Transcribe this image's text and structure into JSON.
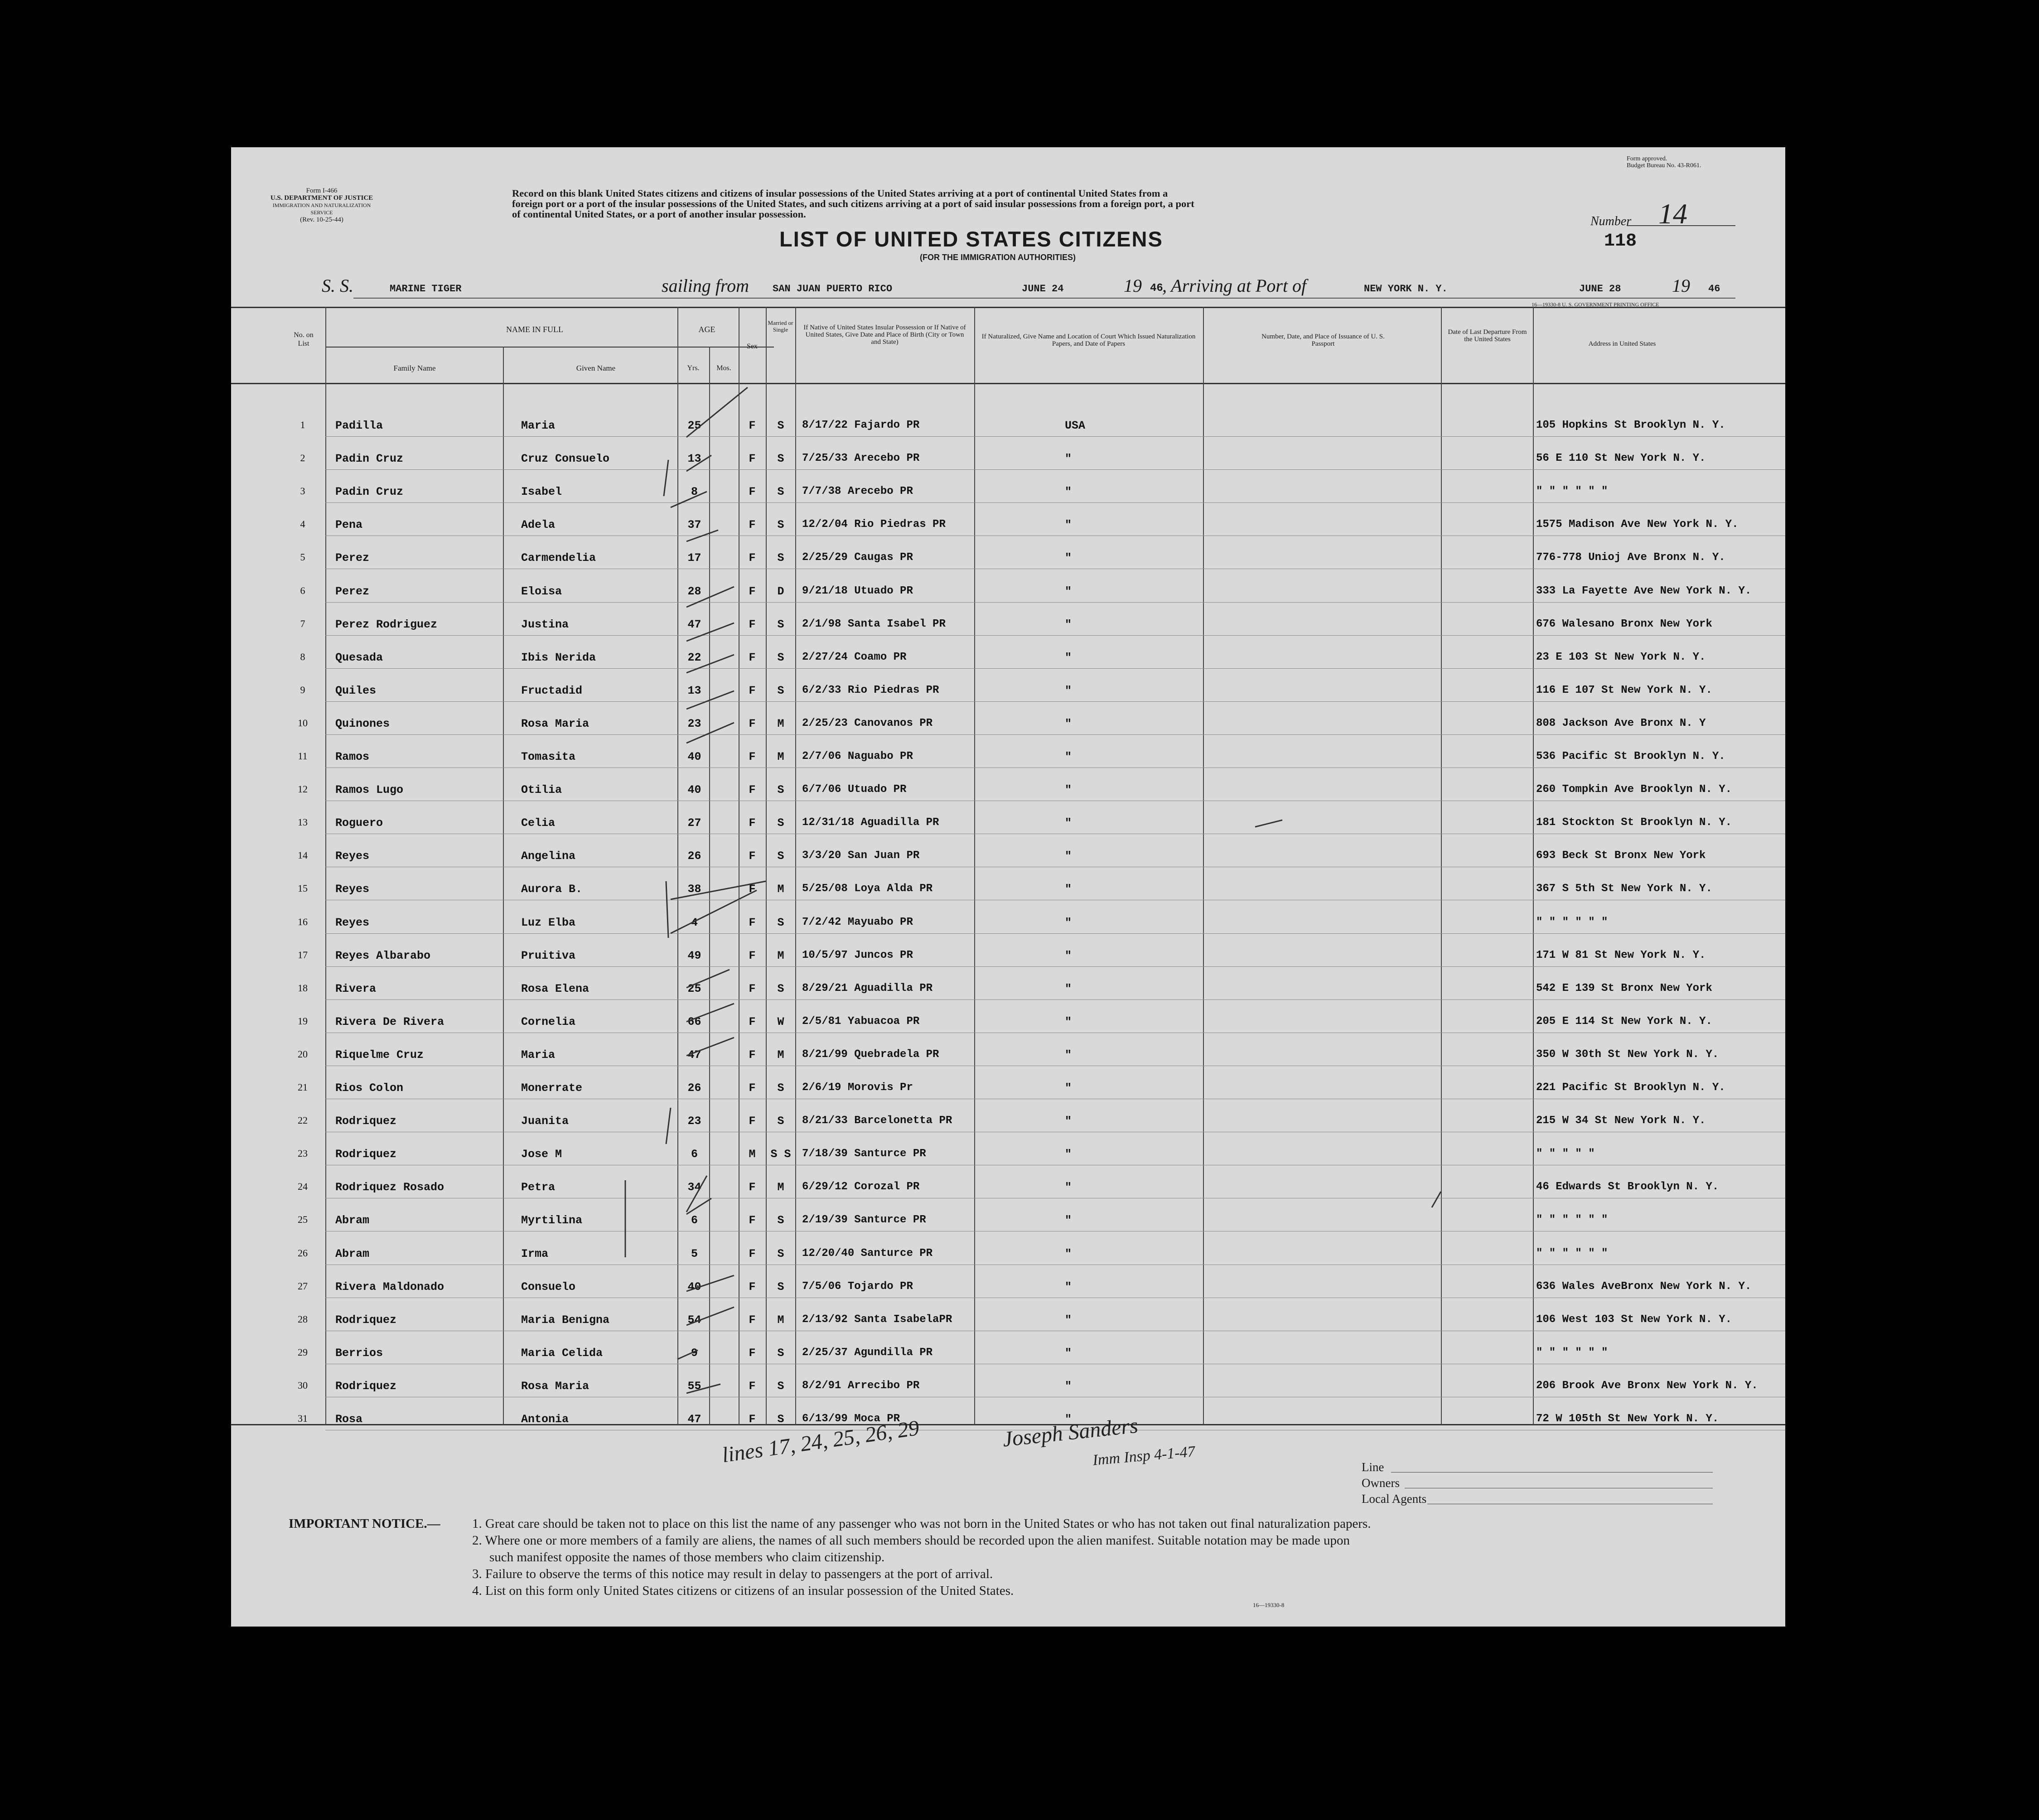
{
  "form": {
    "form_number": "Form I-466",
    "department": "U.S. DEPARTMENT OF JUSTICE",
    "service": "IMMIGRATION AND NATURALIZATION SERVICE",
    "revision": "(Rev. 10-25-44)",
    "approval_1": "Form approved.",
    "approval_2": "Budget Bureau No. 43-R061.",
    "intro_1": "Record on this blank United States citizens and citizens of insular possessions of the United States arriving at a port of continental United States from a",
    "intro_2": "foreign port or a port of the insular possessions of the United States, and such citizens arriving at a port of said insular possessions from a foreign port, a port",
    "intro_3": "of continental United States, or a port of another insular possession.",
    "title": "LIST OF UNITED STATES CITIZENS",
    "subtitle": "(FOR THE IMMIGRATION AUTHORITIES)",
    "number_label": "Number",
    "number_hand": "14",
    "number_typed": "118",
    "ss_label": "S. S.",
    "ship": "MARINE TIGER",
    "sailing_label": "sailing from",
    "sailing_from": "SAN JUAN PUERTO RICO",
    "sail_date": "JUNE 24",
    "year_prefix": "19",
    "year_suffix": "46",
    "arriving_label": ", Arriving at Port of",
    "arrival_port": "NEW YORK N. Y.",
    "arrival_date": "JUNE 28",
    "arrival_year_prefix": "19",
    "arrival_year_suffix": "46",
    "printer_note": "16—19330-8  U. S. GOVERNMENT PRINTING OFFICE",
    "bottom_code": "16—19330-8"
  },
  "columns": {
    "no": "No. on List",
    "name_in_full": "NAME IN FULL",
    "family": "Family Name",
    "given": "Given Name",
    "age": "AGE",
    "yrs": "Yrs.",
    "mos": "Mos.",
    "sex": "Sex",
    "married": "Married or Single",
    "native": "If Native of United States Insular Possession or If Native of United States, Give Date and Place of Birth (City or Town and State)",
    "naturalized": "If Naturalized, Give Name and Location of Court Which Issued Naturalization Papers, and Date of Papers",
    "passport": "Number, Date, and Place of Issuance of U. S. Passport",
    "departure": "Date of Last Departure From the United States",
    "address": "Address in United States"
  },
  "rows": [
    {
      "no": "1",
      "family": "Padilla",
      "given": "Maria",
      "age": "25",
      "sex": "F",
      "ms": "S",
      "birth": "8/17/22 Fajardo PR",
      "nat": "USA",
      "addr": "105 Hopkins St Brooklyn N. Y."
    },
    {
      "no": "2",
      "family": "Padin    Cruz",
      "given": "Cruz Consuelo",
      "age": "13",
      "sex": "F",
      "ms": "S",
      "birth": "7/25/33 Arecebo PR",
      "nat": "\"",
      "addr": "56 E 110 St New York N. Y."
    },
    {
      "no": "3",
      "family": "Padin Cruz",
      "given": "Isabel",
      "age": "8",
      "sex": "F",
      "ms": "S",
      "birth": "7/7/38 Arecebo PR",
      "nat": "\"",
      "addr": "\"    \"    \"    \"    \"    \""
    },
    {
      "no": "4",
      "family": "Pena",
      "given": "Adela",
      "age": "37",
      "sex": "F",
      "ms": "S",
      "birth": "12/2/04 Rio Piedras PR",
      "nat": "\"",
      "addr": "1575 Madison Ave New York N. Y."
    },
    {
      "no": "5",
      "family": "Perez",
      "given": "Carmendelia",
      "age": "17",
      "sex": "F",
      "ms": "S",
      "birth": "2/25/29 Caugas PR",
      "nat": "\"",
      "addr": "776-778 Unioj Ave Bronx N. Y."
    },
    {
      "no": "6",
      "family": "Perez",
      "given": "Eloisa",
      "age": "28",
      "sex": "F",
      "ms": "D",
      "birth": "9/21/18 Utuado PR",
      "nat": "\"",
      "addr": "333 La Fayette Ave New York N. Y."
    },
    {
      "no": "7",
      "family": "Perez Rodriguez",
      "given": "Justina",
      "age": "47",
      "sex": "F",
      "ms": "S",
      "birth": "2/1/98 Santa Isabel PR",
      "nat": "\"",
      "addr": "676 Walesano Bronx New York"
    },
    {
      "no": "8",
      "family": "Quesada",
      "given": "Ibis Nerida",
      "age": "22",
      "sex": "F",
      "ms": "S",
      "birth": "2/27/24 Coamo PR",
      "nat": "\"",
      "addr": "23 E 103 St New York N. Y."
    },
    {
      "no": "9",
      "family": "Quiles",
      "given": "Fructadid",
      "age": "13",
      "sex": "F",
      "ms": "S",
      "birth": "6/2/33 Rio Piedras PR",
      "nat": "\"",
      "addr": "116 E 107 St New York N. Y."
    },
    {
      "no": "10",
      "family": "Quinones",
      "given": "Rosa Maria",
      "age": "23",
      "sex": "F",
      "ms": "M",
      "birth": "2/25/23 Canovanos PR",
      "nat": "\"",
      "addr": "808 Jackson Ave Bronx N. Y"
    },
    {
      "no": "11",
      "family": "Ramos",
      "given": "Tomasita",
      "age": "40",
      "sex": "F",
      "ms": "M",
      "birth": "2/7/06 Naguabo PR",
      "nat": "\"",
      "addr": "536 Pacific St Brooklyn N. Y."
    },
    {
      "no": "12",
      "family": "Ramos Lugo",
      "given": "Otilia",
      "age": "40",
      "sex": "F",
      "ms": "S",
      "birth": "6/7/06 Utuado PR",
      "nat": "\"",
      "addr": "260 Tompkin Ave Brooklyn N. Y."
    },
    {
      "no": "13",
      "family": "Roguero",
      "given": "Celia",
      "age": "27",
      "sex": "F",
      "ms": "S",
      "birth": "12/31/18 Aguadilla PR",
      "nat": "\"",
      "addr": "181 Stockton St Brooklyn N. Y."
    },
    {
      "no": "14",
      "family": "Reyes",
      "given": "Angelina",
      "age": "26",
      "sex": "F",
      "ms": "S",
      "birth": "3/3/20 San Juan PR",
      "nat": "\"",
      "addr": "693 Beck St Bronx New York"
    },
    {
      "no": "15",
      "family": "Reyes",
      "given": "Aurora B.",
      "age": "38",
      "sex": "F",
      "ms": "M",
      "birth": "5/25/08 Loya Alda PR",
      "nat": "\"",
      "addr": "367 S  5th St New York N. Y."
    },
    {
      "no": "16",
      "family": "Reyes",
      "given": "Luz Elba",
      "age": "4",
      "sex": "F",
      "ms": "S",
      "birth": "7/2/42 Mayuabo PR",
      "nat": "\"",
      "addr": "\"    \"    \"    \"    \"    \""
    },
    {
      "no": "17",
      "family": "Reyes Albarabo",
      "given": "Pruitiva",
      "age": "49",
      "sex": "F",
      "ms": "M",
      "birth": "10/5/97 Juncos PR",
      "nat": "\"",
      "addr": "171 W 81 St New York N. Y."
    },
    {
      "no": "18",
      "family": "Rivera",
      "given": "Rosa Elena",
      "age": "25",
      "sex": "F",
      "ms": "S",
      "birth": "8/29/21 Aguadilla PR",
      "nat": "\"",
      "addr": "542 E 139 St Bronx New York"
    },
    {
      "no": "19",
      "family": "Rivera De Rivera",
      "given": "Cornelia",
      "age": "66",
      "sex": "F",
      "ms": "W",
      "birth": "2/5/81 Yabuacoa PR",
      "nat": "\"",
      "addr": "205 E 114 St New York N. Y."
    },
    {
      "no": "20",
      "family": "Riquelme Cruz",
      "given": "Maria",
      "age": "47",
      "sex": "F",
      "ms": "M",
      "birth": "8/21/99 Quebradela PR",
      "nat": "\"",
      "addr": "350 W 30th St New York N. Y."
    },
    {
      "no": "21",
      "family": "Rios Colon",
      "given": "Monerrate",
      "age": "26",
      "sex": "F",
      "ms": "S",
      "birth": "2/6/19 Morovis Pr",
      "nat": "\"",
      "addr": "221 Pacific St Brooklyn N. Y."
    },
    {
      "no": "22",
      "family": "Rodriquez",
      "given": "Juanita",
      "age": "23",
      "sex": "F",
      "ms": "S",
      "birth": "8/21/33 Barcelonetta PR",
      "nat": "\"",
      "addr": "215 W 34 St New York N. Y."
    },
    {
      "no": "23",
      "family": "Rodriquez",
      "given": "Jose M",
      "age": "6",
      "sex": "M",
      "ms": "S S",
      "birth": "7/18/39 Santurce PR",
      "nat": "\"",
      "addr": "\"    \"    \"    \"    \""
    },
    {
      "no": "24",
      "family": "Rodriquez Rosado",
      "given": "Petra",
      "age": "34",
      "sex": "F",
      "ms": "M",
      "birth": "6/29/12 Corozal PR",
      "nat": "\"",
      "addr": "46 Edwards St Brooklyn N. Y."
    },
    {
      "no": "25",
      "family": "Abram",
      "given": "Myrtilina",
      "age": "6",
      "sex": "F",
      "ms": "S",
      "birth": "2/19/39 Santurce PR",
      "nat": "\"",
      "addr": "\"    \"    \"    \"    \"    \""
    },
    {
      "no": "26",
      "family": "Abram",
      "given": "Irma",
      "age": "5",
      "sex": "F",
      "ms": "S",
      "birth": "12/20/40 Santurce PR",
      "nat": "\"",
      "addr": "\"    \"    \"    \"    \"    \""
    },
    {
      "no": "27",
      "family": "Rivera  Maldonado",
      "given": "Consuelo",
      "age": "40",
      "sex": "F",
      "ms": "S",
      "birth": "7/5/06 Tojardo PR",
      "nat": "\"",
      "addr": "636 Wales AveBronx New York N. Y."
    },
    {
      "no": "28",
      "family": "Rodriquez",
      "given": "Maria  Benigna",
      "age": "54",
      "sex": "F",
      "ms": "M",
      "birth": "2/13/92 Santa IsabelaPR",
      "nat": "\"",
      "addr": "106 West 103 St New York N. Y."
    },
    {
      "no": "29",
      "family": "Berrios",
      "given": "Maria Celida",
      "age": "9",
      "sex": "F",
      "ms": "S",
      "birth": "2/25/37 Agundilla PR",
      "nat": "\"",
      "addr": "\"    \"    \"    \"    \"    \""
    },
    {
      "no": "30",
      "family": "Rodriquez",
      "given": "Rosa Maria",
      "age": "55",
      "sex": "F",
      "ms": "S",
      "birth": "8/2/91 Arrecibo PR",
      "nat": "\"",
      "addr": "206 Brook Ave Bronx New York N. Y."
    },
    {
      "no": "31",
      "family": "Rosa",
      "given": "Antonia",
      "age": "47",
      "sex": "F",
      "ms": "S",
      "birth": "6/13/99 Moca PR",
      "nat": "\"",
      "addr": "72 W 105th St New York N. Y."
    }
  ],
  "handwriting": {
    "note_1": "lines 17, 24, 25, 26, 29",
    "note_2": "Joseph Sanders",
    "note_3": "Imm Insp 4-1-47"
  },
  "footer": {
    "line_label": "Line",
    "owners_label": "Owners",
    "agents_label": "Local Agents",
    "notice_title": "IMPORTANT NOTICE.—",
    "notice_1": "1. Great care should be taken not to place on this list the name of any passenger who was not born in the United States or who has not taken out final naturalization papers.",
    "notice_2a": "2. Where one or more members of a family are aliens, the names of all such members should be recorded upon the alien manifest.  Suitable notation may be made upon",
    "notice_2b": "such manifest opposite the names of those members who claim citizenship.",
    "notice_3": "3. Failure to observe the terms of this notice may result in delay to passengers at the port of arrival.",
    "notice_4": "4. List on this form only United States citizens or citizens of an insular possession of the United States."
  }
}
